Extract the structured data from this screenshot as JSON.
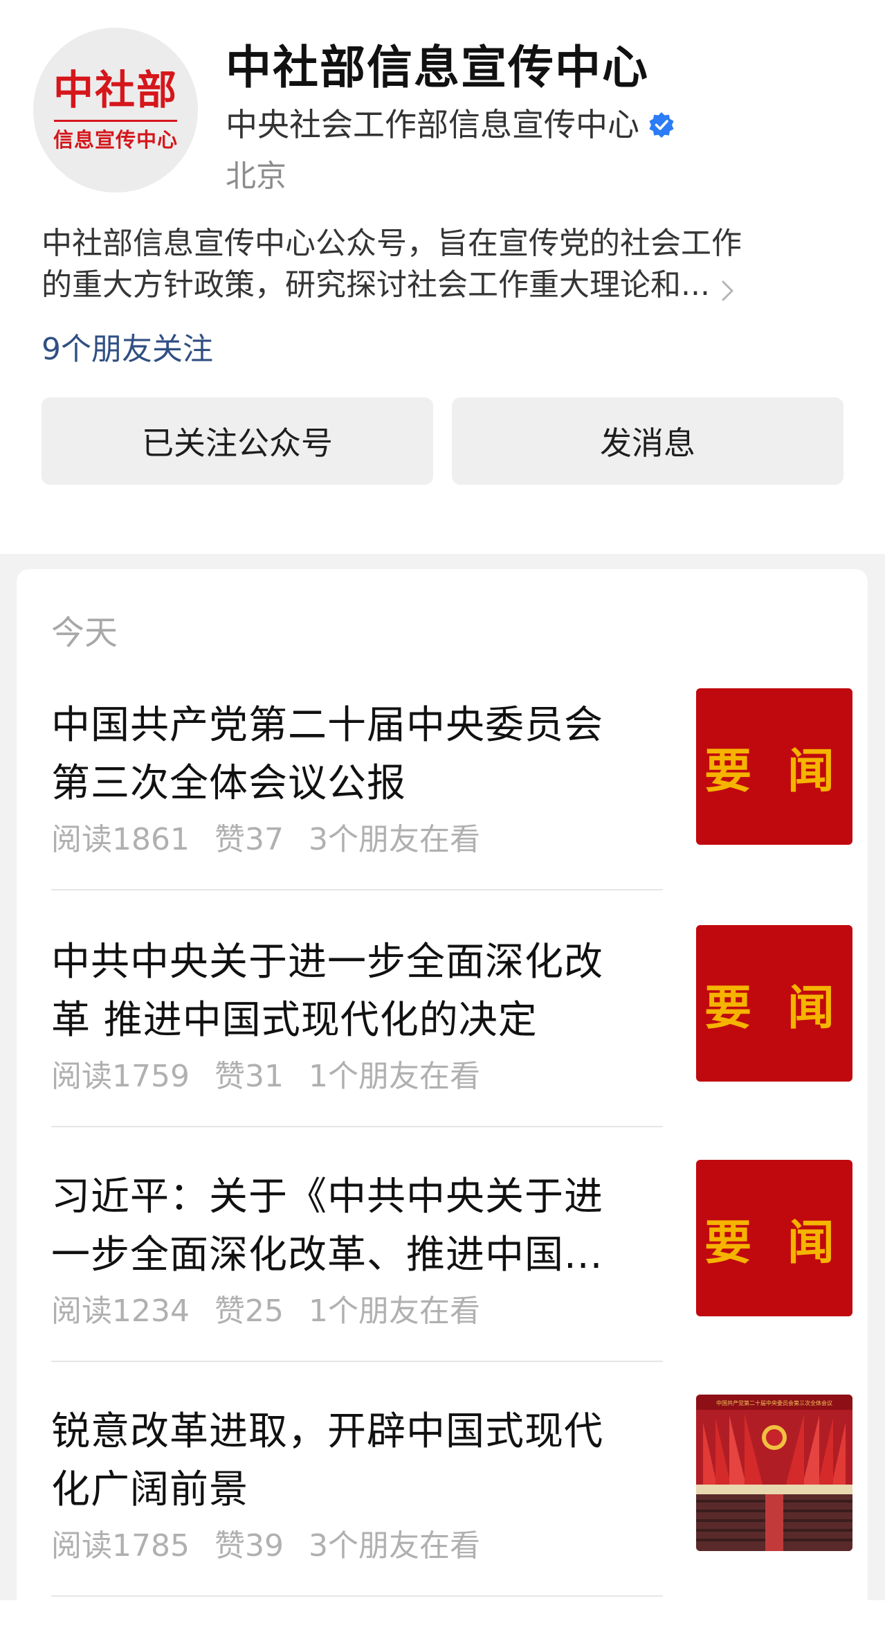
{
  "profile": {
    "avatar_main": "中社部",
    "avatar_sub": "信息宣传中心",
    "name": "中社部信息宣传中心",
    "full_name": "中央社会工作部信息宣传中心",
    "location": "北京",
    "description_line1": "中社部信息宣传中心公众号，旨在宣传党的社会工作",
    "description_line2": "的重大方针政策，研究探讨社会工作重大理论和...",
    "friends_follow": "9个朋友关注",
    "follow_button": "已关注公众号",
    "message_button": "发消息"
  },
  "feed": {
    "date_label": "今天",
    "articles": [
      {
        "title_line1": "中国共产党第二十届中央委员会",
        "title_line2": "第三次全体会议公报",
        "reads": "阅读1861",
        "likes": "赞37",
        "friends": "3个朋友在看",
        "thumb_text": "要 闻"
      },
      {
        "title_line1": "中共中央关于进一步全面深化改",
        "title_line2": "革 推进中国式现代化的决定",
        "reads": "阅读1759",
        "likes": "赞31",
        "friends": "1个朋友在看",
        "thumb_text": "要 闻"
      },
      {
        "title_line1": "习近平：关于《中共中央关于进",
        "title_line2": "一步全面深化改革、推进中国...",
        "reads": "阅读1234",
        "likes": "赞25",
        "friends": "1个朋友在看",
        "thumb_text": "要 闻"
      },
      {
        "title_line1": "锐意改革进取，开辟中国式现代",
        "title_line2": "化广阔前景",
        "reads": "阅读1785",
        "likes": "赞39",
        "friends": "3个朋友在看",
        "thumb_caption": "中国共产党第二十届中央委员会第三次全体会议"
      }
    ]
  },
  "colors": {
    "brand_red": "#d5161b",
    "thumb_red": "#c0090f",
    "thumb_gold": "#f5b400",
    "link_blue": "#304f83",
    "verified_blue": "#2b7cf6"
  },
  "icons": [
    "verified-icon",
    "chevron-right-icon"
  ]
}
